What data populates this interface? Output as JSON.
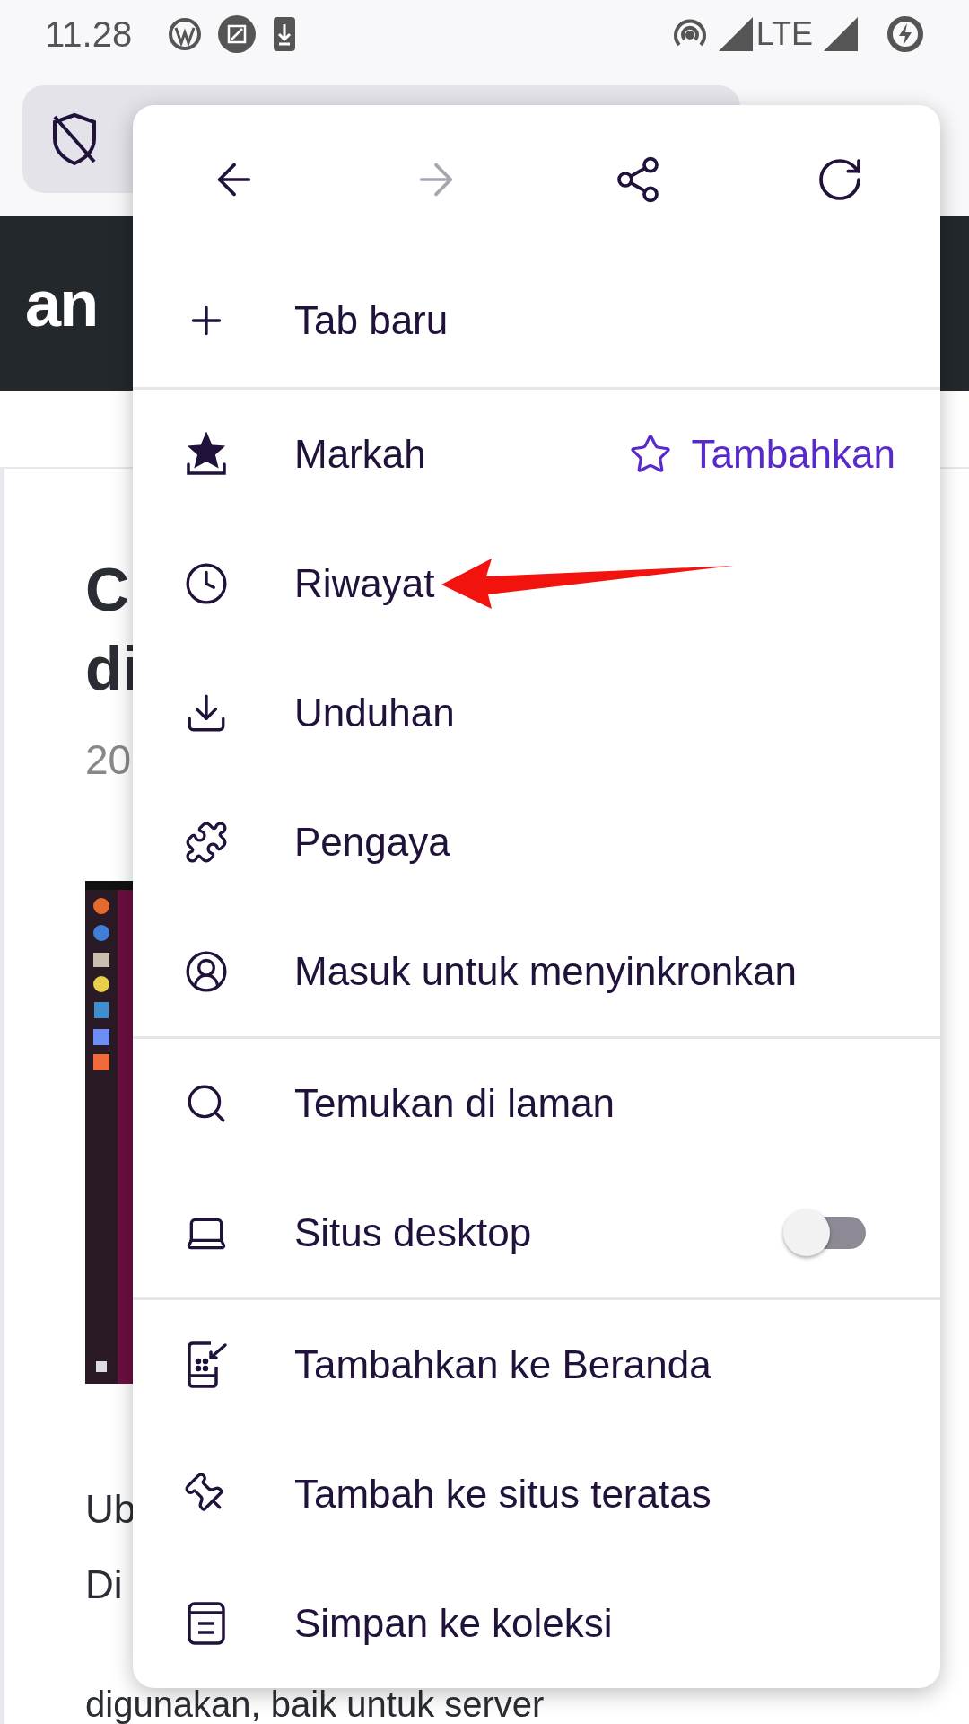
{
  "status_bar": {
    "time": "11.28",
    "network": "LTE"
  },
  "site_header": {
    "logo": "an"
  },
  "article": {
    "title_lines": [
      "C",
      "di"
    ],
    "date": "20",
    "body_lines": [
      "Ub",
      "Di"
    ],
    "last_line": "digunakan, baik untuk server"
  },
  "menu": {
    "nav": [
      {
        "disabled": false
      },
      {
        "disabled": true
      },
      {
        "disabled": false
      },
      {
        "disabled": false
      }
    ],
    "sections": [
      [
        {
          "kind": "item",
          "label": "Tab baru"
        }
      ],
      [
        {
          "kind": "item",
          "label": "Markah",
          "action": "Tambahkan"
        },
        {
          "kind": "item",
          "label": "Riwayat"
        },
        {
          "kind": "item",
          "label": "Unduhan"
        },
        {
          "kind": "item",
          "label": "Pengaya"
        },
        {
          "kind": "item",
          "label": "Masuk untuk menyinkronkan"
        }
      ],
      [
        {
          "kind": "item",
          "label": "Temukan di laman"
        },
        {
          "kind": "toggle",
          "label": "Situs desktop",
          "on": false
        }
      ],
      [
        {
          "kind": "item",
          "label": "Tambahkan ke Beranda"
        },
        {
          "kind": "item",
          "label": "Tambah ke situs teratas"
        },
        {
          "kind": "item",
          "label": "Simpan ke koleksi"
        }
      ]
    ]
  }
}
